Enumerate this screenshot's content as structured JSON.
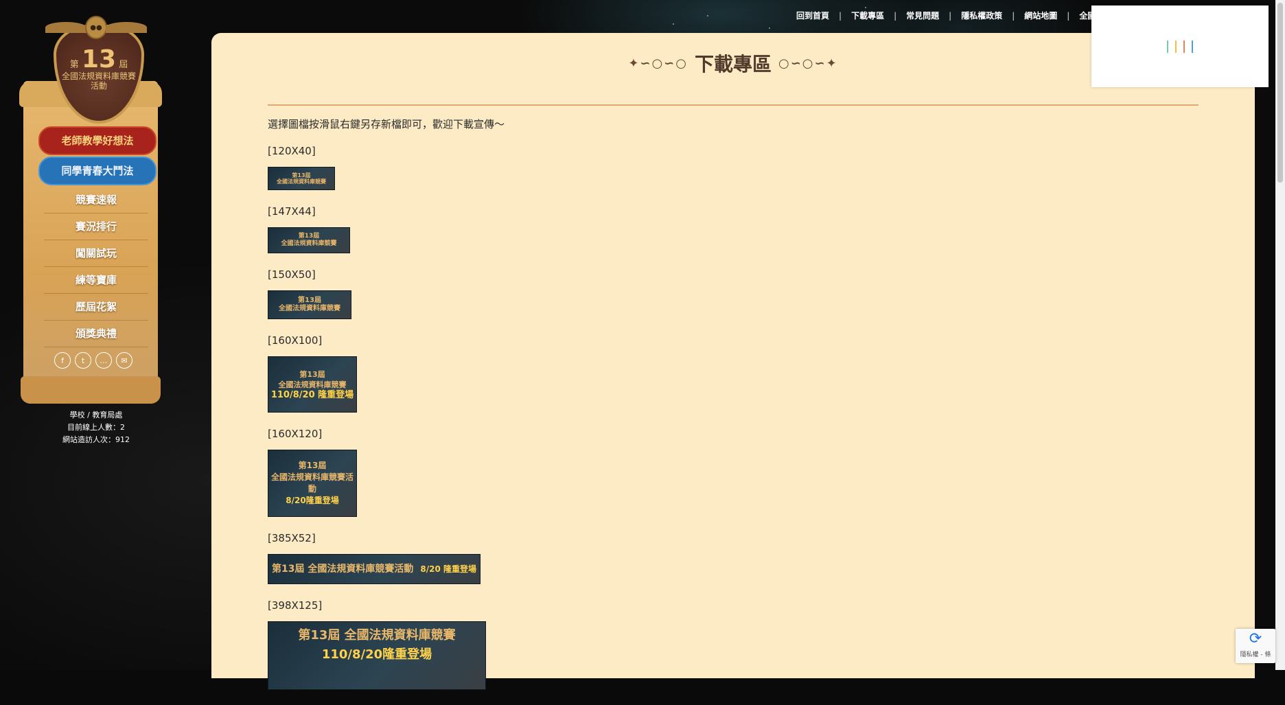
{
  "topnav": {
    "items": [
      "回到首頁",
      "下載專區",
      "常見問題",
      "隱私權政策",
      "網站地圖",
      "全國"
    ],
    "separator": "|"
  },
  "sidebar": {
    "badge": {
      "top": "第",
      "number": "13",
      "suffix": "屆",
      "subtitle": "全國法規資料庫競賽活動"
    },
    "pill_red": "老師教學好想法",
    "pill_blue": "同學青春大鬥法",
    "menu": [
      "競賽速報",
      "賽況排行",
      "闖關試玩",
      "練等寶庫",
      "歷屆花絮",
      "頒獎典禮"
    ],
    "socials": [
      {
        "icon": "facebook-icon",
        "glyph": "f"
      },
      {
        "icon": "twitter-icon",
        "glyph": "t"
      },
      {
        "icon": "line-icon",
        "glyph": "…"
      },
      {
        "icon": "mail-icon",
        "glyph": "✉"
      }
    ],
    "stats": {
      "org": "學校 / 教育局處",
      "online": "目前線上人數：2",
      "visits": "網站造訪人次：912"
    }
  },
  "main": {
    "title": "下載專區",
    "intro": "選擇圖檔按滑鼠右鍵另存新檔即可，歡迎下載宣傳～",
    "banners": [
      {
        "label": "[120X40]",
        "line1": "第13屆",
        "line2": "全國法規資料庫競賽",
        "line3": ""
      },
      {
        "label": "[147X44]",
        "line1": "第13屆",
        "line2": "全國法規資料庫競賽",
        "line3": ""
      },
      {
        "label": "[150X50]",
        "line1": "第13屆",
        "line2": "全國法規資料庫競賽",
        "line3": ""
      },
      {
        "label": "[160X100]",
        "line1": "第13屆",
        "line2": "全國法規資料庫競賽",
        "line3": "110/8/20 隆重登場"
      },
      {
        "label": "[160X120]",
        "line1": "第13屆",
        "line2": "全國法規資料庫競賽活動",
        "line3": "8/20隆重登場"
      },
      {
        "label": "[385X52]",
        "line1": "第13屆 全國法規資料庫競賽活動",
        "line2": "8/20 隆重登場",
        "line3": ""
      },
      {
        "label": "[398X125]",
        "line1": "第13屆 全國法規資料庫競賽",
        "line2": "110/8/20隆重登場",
        "line3": ""
      }
    ]
  },
  "recaptcha": {
    "text": "隱私權 - 條"
  },
  "colors": {
    "panel": "#fdebc6",
    "accent_line": "#e3a86d",
    "pill_red": "#a8231b",
    "pill_blue": "#2673b8"
  }
}
